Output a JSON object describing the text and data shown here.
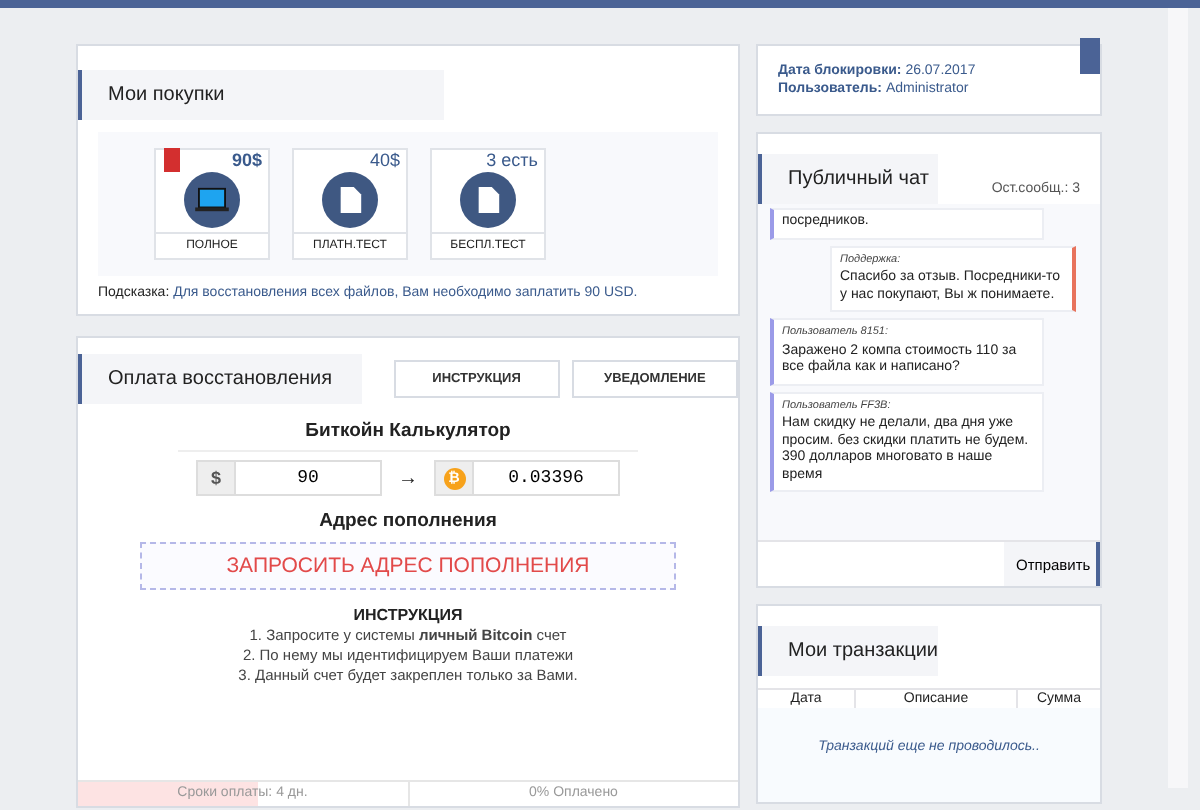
{
  "purchases": {
    "title": "Мои покупки",
    "items": [
      {
        "price": "90$",
        "label": "ПОЛНОЕ",
        "kind": "laptop",
        "selected": true
      },
      {
        "price": "40$",
        "label": "ПЛАТН.ТЕСТ",
        "kind": "document",
        "selected": false
      },
      {
        "price": "3 есть",
        "label": "БЕСПЛ.ТЕСТ",
        "kind": "document",
        "selected": false
      }
    ],
    "hint_label": "Подсказка:",
    "hint": "Для восстановления всех файлов, Вам необходимо заплатить 90 USD."
  },
  "payment": {
    "title": "Оплата восстановления",
    "buttons": [
      "ИНСТРУКЦИЯ",
      "УВЕДОМЛЕНИЕ"
    ],
    "calc_title": "Биткойн Калькулятор",
    "usd_symbol": "$",
    "usd_value": "90",
    "arrow": "→",
    "btc_symbol": "₿",
    "btc_value": "0.03396",
    "address_title": "Адрес пополнения",
    "address_button": "ЗАПРОСИТЬ АДРЕС ПОПОЛНЕНИЯ",
    "instruction_title": "ИНСТРУКЦИЯ",
    "instructions": [
      "1. Запросите у системы **личный Bitcoin** счет",
      "2. По нему мы идентифицируем Ваши платежи",
      "3. Данный счет будет закреплен только за Вами."
    ],
    "deadline": {
      "text": "Сроки оплаты: 4 дн.",
      "level": 0.55
    },
    "paid": "0% Оплачено"
  },
  "info": {
    "date_label": "Дата блокировки:",
    "date": "26.07.2017",
    "user_label": "Пользователь:",
    "user": "Administrator"
  },
  "chat": {
    "title": "Публичный чат",
    "remaining": "Ост.сообщ.: 3",
    "messages": [
      {
        "kind": "user",
        "text": "посредников."
      },
      {
        "kind": "support",
        "author": "Поддержка:",
        "text": "Спасибо за отзыв. Посредники-то у нас покупают, Вы ж понимаете."
      },
      {
        "kind": "user",
        "author": "Пользователь 8151:",
        "text": "Заражено 2 компа стоимость 110 за все файла как и написано?"
      },
      {
        "kind": "user",
        "author": "Пользователь FF3B:",
        "text": "Нам скидку не делали, два дня уже просим. без скидки платить не будем. 390 долларов многовато в наше время"
      }
    ],
    "send": "Отправить"
  },
  "transactions": {
    "title": "Мои транзакции",
    "columns": [
      "Дата",
      "Описание",
      "Сумма"
    ],
    "empty": "Транзакций еще не проводилось.."
  }
}
